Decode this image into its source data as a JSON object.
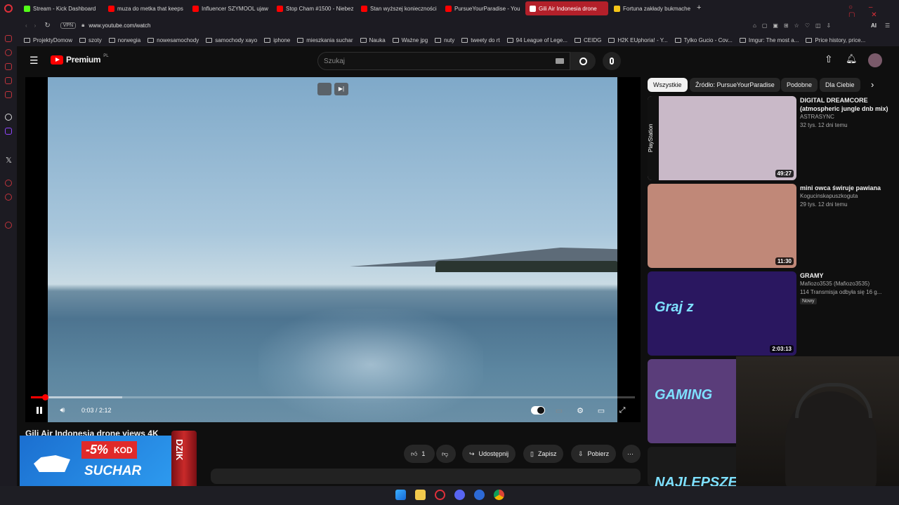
{
  "browser": {
    "tabs": [
      {
        "label": "Stream - Kick Dashboard",
        "color": "#53fc18"
      },
      {
        "label": "muza do metka that keeps",
        "color": "#ff0000"
      },
      {
        "label": "Influencer SZYMOOL ujaw",
        "color": "#ff0000"
      },
      {
        "label": "Stop Cham #1500 - Niebez",
        "color": "#ff0000"
      },
      {
        "label": "Stan wyższej konieczności",
        "color": "#ff0000"
      },
      {
        "label": "PursueYourParadise - You",
        "color": "#ff0000"
      },
      {
        "label": "Gili Air Indonesia drone",
        "color": "#ffffff",
        "active": true
      },
      {
        "label": "Fortuna zakłady bukmache",
        "color": "#f5c518"
      }
    ],
    "vpn_label": "VPN",
    "url": "www.youtube.com/watch",
    "ai_label": "AI",
    "bookmarks": [
      "ProjektyDomow",
      "szoty",
      "norwegia",
      "nowesamochody",
      "samochody xayo",
      "iphone",
      "mieszkania suchar",
      "Nauka",
      "Ważne jpg",
      "nuty",
      "tweety do rt",
      "94 League of Lege...",
      "CEIDG",
      "H2K EUphoria! - Y...",
      "Tylko Gucio - Cov...",
      "Imgur: The most a...",
      "Price history, price..."
    ]
  },
  "youtube": {
    "logo_text": "Premium",
    "logo_region": "PL",
    "search_placeholder": "Szukaj"
  },
  "player": {
    "time": "0:03 / 2:12",
    "progress_fraction": 0.023,
    "title": "Gili Air Indonesia drone views 4K"
  },
  "actions": {
    "like_count": "1",
    "share": "Udostępnij",
    "save": "Zapisz",
    "download": "Pobierz"
  },
  "ad": {
    "discount": "-5%",
    "kod": "KOD",
    "code": "SUCHAR",
    "brand": "DZIK"
  },
  "chips": [
    "Wszystkie",
    "Źródło: PursueYourParadise",
    "Podobne",
    "Dla Ciebie"
  ],
  "recommendations": [
    {
      "title": "DIGITAL DREAMCORE (atmospheric jungle dnb mix)",
      "channel": "ASTRASYNC",
      "meta": "32 tys.  12 dni temu",
      "duration": "49:27",
      "thumb_color": "#c9b9c8",
      "side_label": "PlayStation"
    },
    {
      "title": "mini owca świruje pawiana",
      "channel": "Kogucinskapuszkoguta",
      "meta": "29 tys.  12 dni temu",
      "duration": "11:30",
      "thumb_color": "#c08878"
    },
    {
      "title": "GRAMY",
      "channel": "Mafiozo3535 (Mafiozo3535)",
      "meta": "114  Transmisja odbyła się 16 g...",
      "duration": "2:03:13",
      "badge": "Nowy",
      "thumb_color": "#2a1760",
      "thumb_text": "Graj z"
    },
    {
      "title": "",
      "channel": "",
      "meta": "",
      "duration": "",
      "thumb_color": "#5a3d7a",
      "thumb_text": "GAMING"
    },
    {
      "title": "",
      "channel": "",
      "meta": "",
      "duration": "",
      "thumb_color": "#1a1a1a",
      "thumb_text": "NAJLEPSZE M"
    }
  ]
}
